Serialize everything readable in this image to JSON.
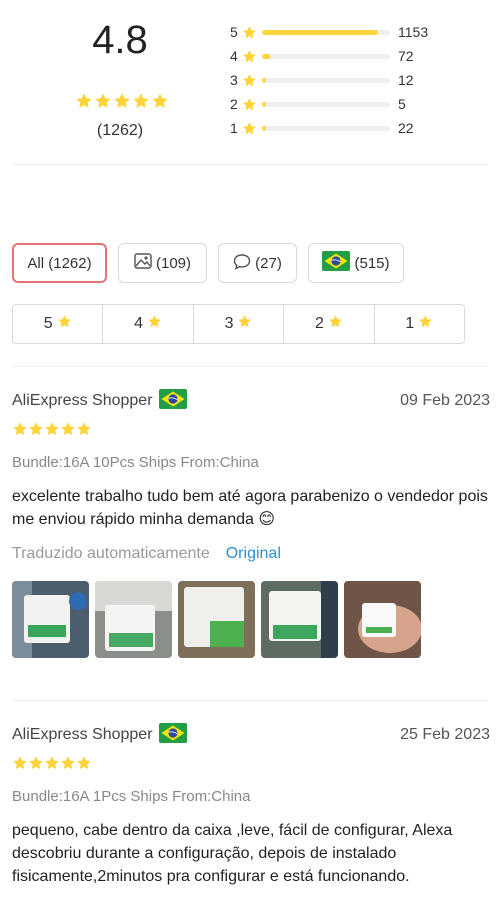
{
  "summary": {
    "average": "4.8",
    "total": "(1262)",
    "distribution": [
      {
        "star": "5",
        "count": "1153",
        "fraction": 0.91
      },
      {
        "star": "4",
        "count": "72",
        "fraction": 0.06
      },
      {
        "star": "3",
        "count": "12",
        "fraction": 0.02
      },
      {
        "star": "2",
        "count": "5",
        "fraction": 0.0
      },
      {
        "star": "1",
        "count": "22",
        "fraction": 0.02
      }
    ]
  },
  "filters": {
    "all": "All (1262)",
    "photos": "(109)",
    "comments": "(27)",
    "country": "(515)"
  },
  "star_filters": [
    "5",
    "4",
    "3",
    "2",
    "1"
  ],
  "reviews": [
    {
      "user": "AliExpress Shopper",
      "date": "09 Feb 2023",
      "variant": "Bundle:16A 10Pcs Ships From:China",
      "text": "excelente trabalho tudo bem até agora parabenizo o vendedor pois me enviou rápido minha demanda 😊",
      "translated_label": "Traduzido automaticamente",
      "original_label": "Original"
    },
    {
      "user": "AliExpress Shopper",
      "date": "25 Feb 2023",
      "variant": "Bundle:16A 1Pcs Ships From:China",
      "text": "pequeno, cabe dentro da caixa ,leve, fácil de configurar, Alexa descobriu durante a configuração, depois de instalado fisicamente,2minutos pra configurar e está funcionando."
    }
  ],
  "colors": {
    "star": "#ffd43b",
    "active_chip_border": "#e57373",
    "link": "#2d8fd5"
  },
  "icons": [
    "star-icon",
    "image-icon",
    "comment-icon",
    "brazil-flag-icon"
  ]
}
